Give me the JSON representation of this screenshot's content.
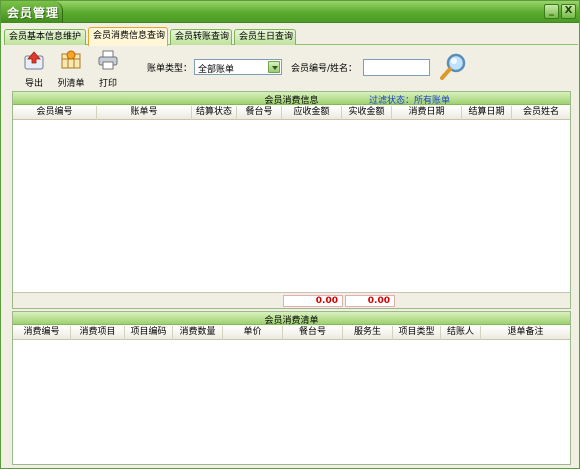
{
  "window": {
    "title": "会员管理",
    "minimize": "_",
    "close": "X"
  },
  "tabs": [
    {
      "label": "会员基本信息维护",
      "active": false
    },
    {
      "label": "会员消费信息查询",
      "active": true
    },
    {
      "label": "会员转账查询",
      "active": false
    },
    {
      "label": "会员生日查询",
      "active": false
    }
  ],
  "toolbar": {
    "export_label": "导出",
    "columns_label": "列清单",
    "print_label": "打印",
    "bill_type_label": "账单类型：",
    "bill_type_value": "全部账单",
    "member_id_label": "会员编号/姓名：",
    "member_id_value": ""
  },
  "consumption_info": {
    "title": "会员消费信息",
    "filter_label": "过滤状态：所有账单",
    "columns": [
      "会员编号",
      "账单号",
      "结算状态",
      "餐台号",
      "应收金额",
      "实收金额",
      "消费日期",
      "结算日期",
      "会员姓名"
    ],
    "total_receivable": "0.00",
    "total_received": "0.00"
  },
  "consumption_list": {
    "title": "会员消费清单",
    "columns": [
      "消费编号",
      "消费项目",
      "项目编码",
      "消费数量",
      "单价",
      "餐台号",
      "服务生",
      "项目类型",
      "结账人",
      "退单备注"
    ]
  },
  "colors": {
    "title_green": "#5aab2d",
    "header_green": "#9ed16f",
    "active_tab": "#fff7d8",
    "total_red": "#d40000",
    "filter_blue": "#1a3fd1"
  }
}
